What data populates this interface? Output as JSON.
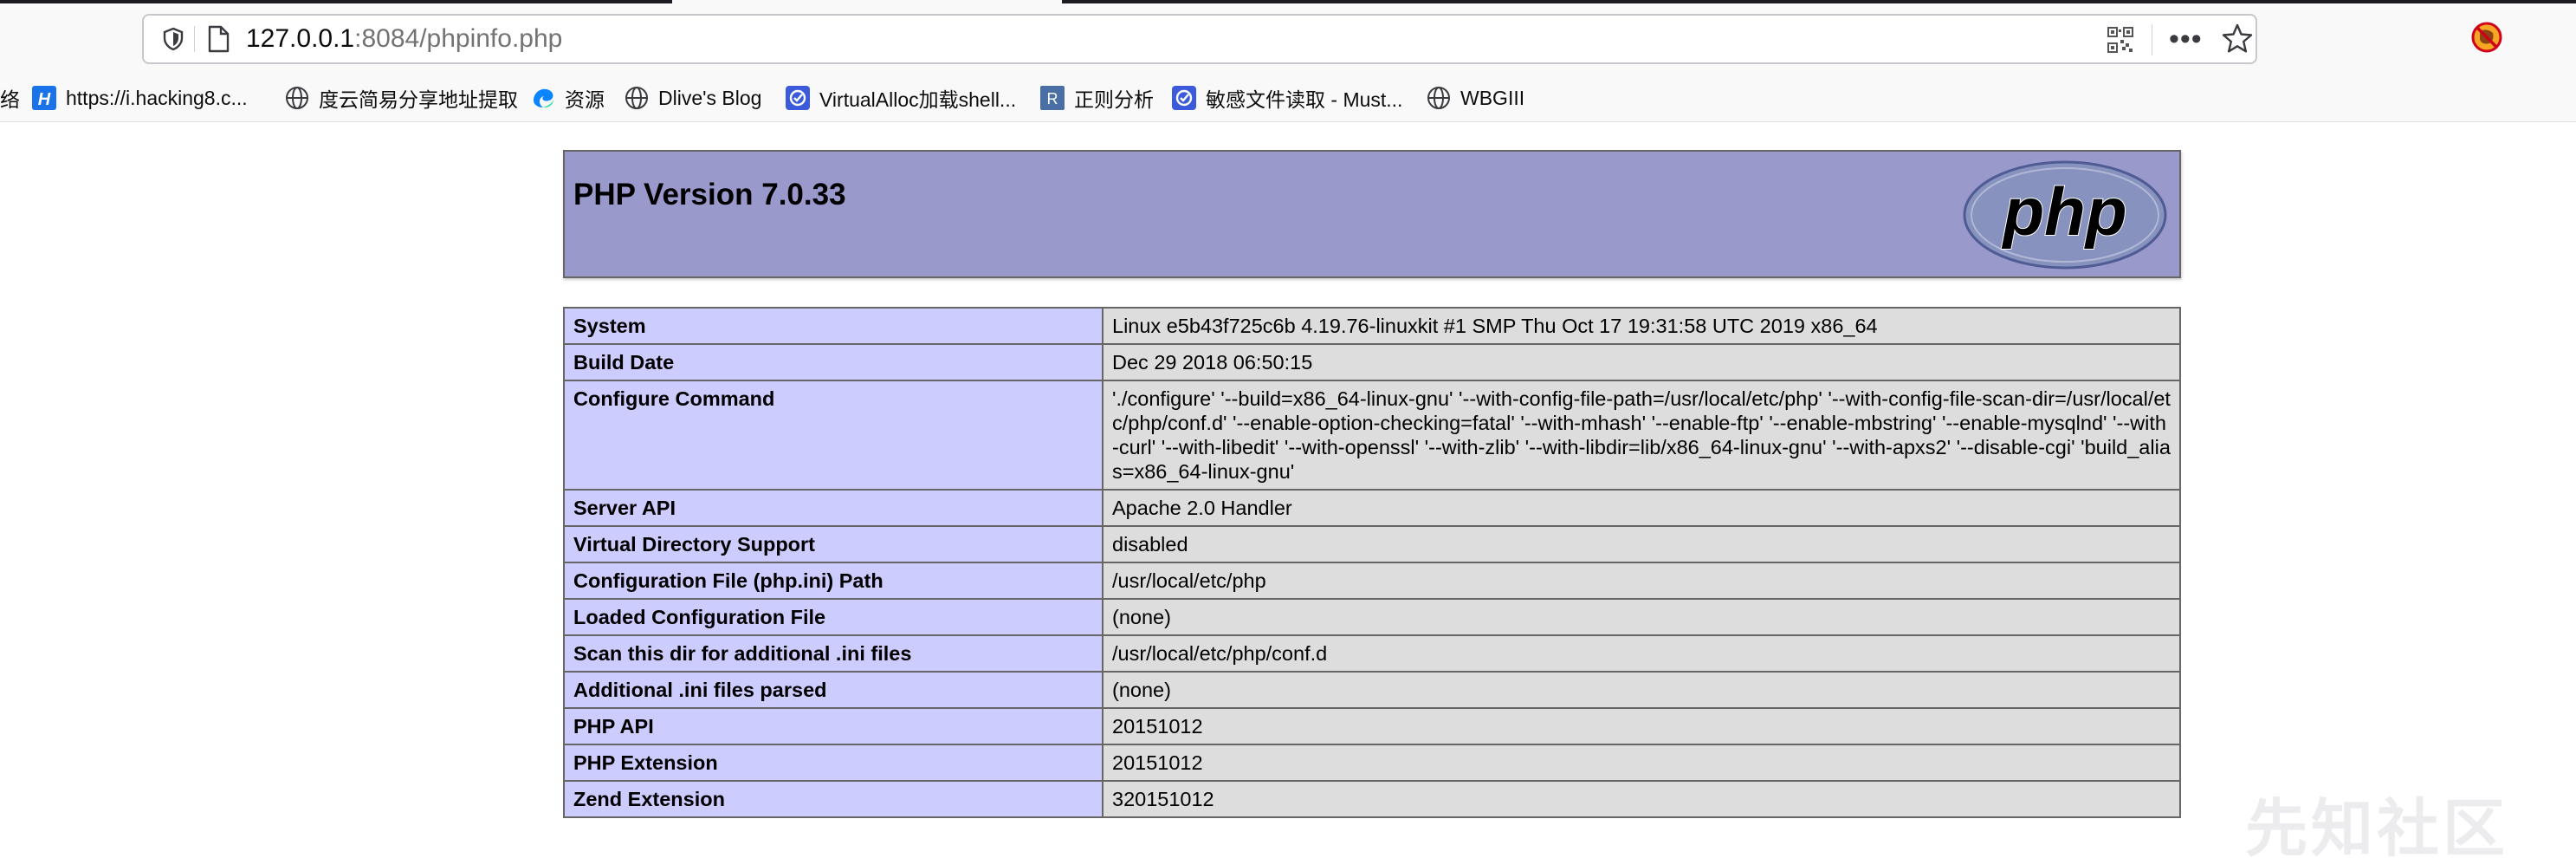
{
  "browser": {
    "url_host": "127.0.0.1",
    "url_rest": ":8084/phpinfo.php",
    "icons": {
      "shield": "tracking-shield-icon",
      "page": "page-icon",
      "qr": "qr-code-icon",
      "more": "more-actions-icon",
      "star": "bookmark-star-icon",
      "extension": "extension-icon"
    },
    "bookmarks": [
      {
        "label": "络",
        "icon": "none"
      },
      {
        "label": "https://i.hacking8.c...",
        "icon": "h-logo-icon"
      },
      {
        "label": "度云简易分享地址提取",
        "icon": "globe-icon"
      },
      {
        "label": "资源",
        "icon": "edge-wave-icon"
      },
      {
        "label": "Dlive's Blog",
        "icon": "globe-icon"
      },
      {
        "label": "VirtualAlloc加载shell...",
        "icon": "blue-badge-icon"
      },
      {
        "label": "正则分析",
        "icon": "r-logo-icon"
      },
      {
        "label": "敏感文件读取 - Must...",
        "icon": "blue-badge-icon"
      },
      {
        "label": "WBGIII",
        "icon": "globe-icon"
      }
    ]
  },
  "phpinfo": {
    "title": "PHP Version 7.0.33",
    "logo_text": "php",
    "colors": {
      "header": "#9999cc",
      "key_cell": "#ccccff",
      "value_cell": "#dddddd",
      "border": "#666666"
    },
    "rows": [
      {
        "key": "System",
        "value": "Linux e5b43f725c6b 4.19.76-linuxkit #1 SMP Thu Oct 17 19:31:58 UTC 2019 x86_64"
      },
      {
        "key": "Build Date",
        "value": "Dec 29 2018 06:50:15"
      },
      {
        "key": "Configure Command",
        "value": "'./configure' '--build=x86_64-linux-gnu' '--with-config-file-path=/usr/local/etc/php' '--with-config-file-scan-dir=/usr/local/etc/php/conf.d' '--enable-option-checking=fatal' '--with-mhash' '--enable-ftp' '--enable-mbstring' '--enable-mysqlnd' '--with-curl' '--with-libedit' '--with-openssl' '--with-zlib' '--with-libdir=lib/x86_64-linux-gnu' '--with-apxs2' '--disable-cgi' 'build_alias=x86_64-linux-gnu'"
      },
      {
        "key": "Server API",
        "value": "Apache 2.0 Handler"
      },
      {
        "key": "Virtual Directory Support",
        "value": "disabled"
      },
      {
        "key": "Configuration File (php.ini) Path",
        "value": "/usr/local/etc/php"
      },
      {
        "key": "Loaded Configuration File",
        "value": "(none)"
      },
      {
        "key": "Scan this dir for additional .ini files",
        "value": "/usr/local/etc/php/conf.d"
      },
      {
        "key": "Additional .ini files parsed",
        "value": "(none)"
      },
      {
        "key": "PHP API",
        "value": "20151012"
      },
      {
        "key": "PHP Extension",
        "value": "20151012"
      },
      {
        "key": "Zend Extension",
        "value": "320151012"
      }
    ]
  },
  "watermark": "先知社区"
}
